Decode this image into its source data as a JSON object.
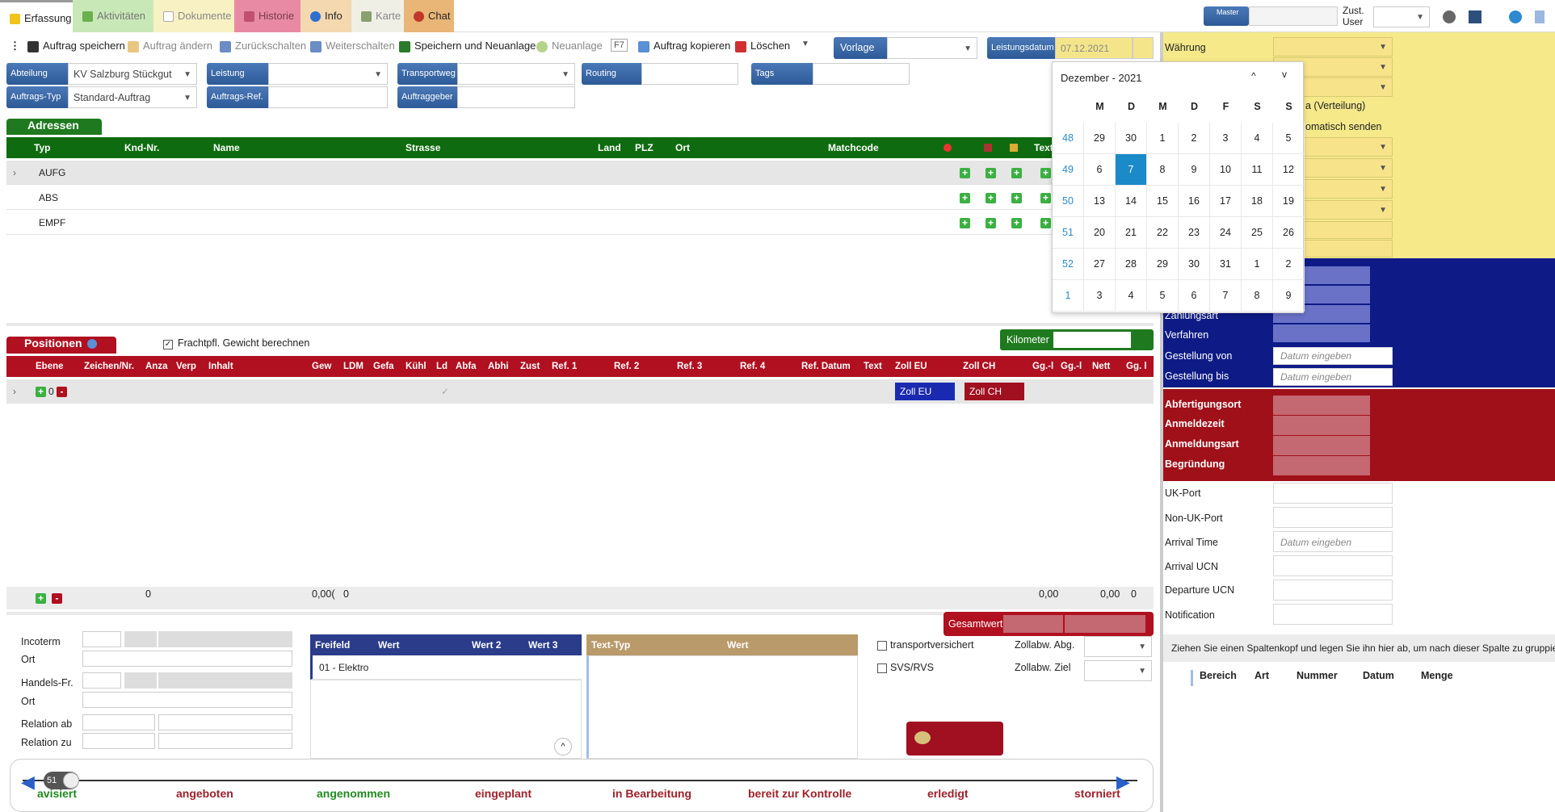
{
  "tabs": [
    {
      "label": "Erfassung"
    },
    {
      "label": "Aktivitäten"
    },
    {
      "label": "Dokumente"
    },
    {
      "label": "Historie"
    },
    {
      "label": "Info"
    },
    {
      "label": "Karte"
    },
    {
      "label": "Chat"
    }
  ],
  "topright": {
    "master": "Master",
    "zust_user": "Zust.\nUser"
  },
  "toolbar": {
    "save": "Auftrag speichern",
    "change": "Auftrag ändern",
    "back": "Zurückschalten",
    "forward": "Weiterschalten",
    "save_new": "Speichern und Neuanlage",
    "new": "Neuanlage",
    "f7": "F7",
    "copy": "Auftrag kopieren",
    "delete": "Löschen",
    "vorlage": "Vorlage",
    "leistungsdatum": "Leistungsdatum",
    "leistungsdatum_value": "07.12.2021"
  },
  "form": {
    "abteilung": "Abteilung",
    "abteilung_value": "KV Salzburg Stückgut",
    "leistung": "Leistung",
    "transportweg": "Transportweg",
    "routing": "Routing",
    "tags": "Tags",
    "auftragstyp": "Auftrags-Typ",
    "auftragstyp_value": "Standard-Auftrag",
    "auftragsref": "Auftrags-Ref.",
    "auftraggeber": "Auftraggeber"
  },
  "adressen": {
    "title": "Adressen",
    "headers": [
      "Typ",
      "Knd-Nr.",
      "Name",
      "Strasse",
      "Land",
      "PLZ",
      "Ort",
      "Matchcode",
      "Text"
    ],
    "rows": [
      "AUFG",
      "ABS",
      "EMPF"
    ]
  },
  "positionen": {
    "title": "Positionen",
    "checkbox": "Frachtpfl. Gewicht berechnen",
    "kilometer": "Kilometer",
    "headers": [
      "Ebene",
      "Zeichen/Nr.",
      "Anza",
      "Verp",
      "Inhalt",
      "Gew",
      "LDM",
      "Gefa",
      "Kühl",
      "Ld",
      "Abfa",
      "Abhi",
      "Zust",
      "Ref. 1",
      "Ref. 2",
      "Ref. 3",
      "Ref. 4",
      "Ref. Datum",
      "Text",
      "Zoll EU",
      "Zoll CH",
      "Gg.-l",
      "Gg.-l",
      "Nett",
      "Gg. l"
    ],
    "row_level": "0",
    "zoll_eu": "Zoll EU",
    "zoll_ch": "Zoll CH",
    "totals": {
      "anz": "0",
      "gew": "0,00(",
      "ldm": "0",
      "gg": "0,00",
      "nett": "0,00",
      "gg2": "0"
    }
  },
  "bottom": {
    "incoterm": "Incoterm",
    "ort": "Ort",
    "handelsfr": "Handels-Fr.",
    "ort2": "Ort",
    "relation_ab": "Relation ab",
    "relation_zu": "Relation zu",
    "freifeld_headers": [
      "Freifeld",
      "Wert",
      "Wert 2",
      "Wert 3"
    ],
    "freifeld_row": "01 - Elektro",
    "text_headers": [
      "Text-Typ",
      "Wert"
    ],
    "gesamtwert": "Gesamtwert",
    "transportversichert": "transportversichert",
    "svs": "SVS/RVS",
    "zollabw_abg": "Zollabw. Abg.",
    "zollabw_ziel": "Zollabw. Ziel"
  },
  "calendar": {
    "month": "Dezember - 2021",
    "weekdays": [
      "M",
      "D",
      "M",
      "D",
      "F",
      "S",
      "S"
    ],
    "weeks": [
      {
        "wk": "48",
        "days": [
          "29",
          "30",
          "1",
          "2",
          "3",
          "4",
          "5"
        ]
      },
      {
        "wk": "49",
        "days": [
          "6",
          "7",
          "8",
          "9",
          "10",
          "11",
          "12"
        ]
      },
      {
        "wk": "50",
        "days": [
          "13",
          "14",
          "15",
          "16",
          "17",
          "18",
          "19"
        ]
      },
      {
        "wk": "51",
        "days": [
          "20",
          "21",
          "22",
          "23",
          "24",
          "25",
          "26"
        ]
      },
      {
        "wk": "52",
        "days": [
          "27",
          "28",
          "29",
          "30",
          "31",
          "1",
          "2"
        ]
      },
      {
        "wk": "1",
        "days": [
          "3",
          "4",
          "5",
          "6",
          "7",
          "8",
          "9"
        ]
      }
    ]
  },
  "right": {
    "waehrung": "Währung",
    "verteilung": "a (Verteilung)",
    "auto_send": "omatisch senden",
    "zahlungsart": "Zahlungsart",
    "verfahren": "Verfahren",
    "gestellung_von": "Gestellung von",
    "gestellung_bis": "Gestellung bis",
    "date_placeholder": "Datum eingeben",
    "abfertigungsort": "Abfertigungsort",
    "anmeldezeit": "Anmeldezeit",
    "anmeldungsart": "Anmeldungsart",
    "begruendung": "Begründung",
    "uk_port": "UK-Port",
    "non_uk_port": "Non-UK-Port",
    "arrival_time": "Arrival Time",
    "arrival_ucn": "Arrival UCN",
    "departure_ucn": "Departure UCN",
    "notification": "Notification",
    "group_hint": "Ziehen Sie einen Spaltenkopf und legen Sie ihn hier ab, um nach dieser Spalte zu gruppie",
    "grid_headers": [
      "Bereich",
      "Art",
      "Nummer",
      "Datum",
      "Menge"
    ]
  },
  "status": {
    "slider_value": "51",
    "steps": [
      "avisiert",
      "angeboten",
      "angenommen",
      "eingeplant",
      "in Bearbeitung",
      "bereit zur Kontrolle",
      "erledigt",
      "storniert"
    ]
  }
}
